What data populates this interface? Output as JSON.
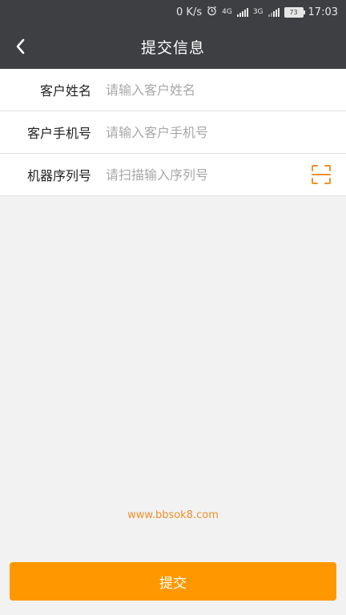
{
  "status_bar": {
    "net_speed": "0 K/s",
    "network_4g": "4G",
    "network_3g": "3G",
    "battery": "73",
    "time": "17:03",
    "icons": [
      "alarm-icon",
      "signal-icon",
      "battery-icon"
    ]
  },
  "header": {
    "title": "提交信息",
    "back_icon": "chevron-left-icon"
  },
  "form": {
    "fields": [
      {
        "label": "客户姓名",
        "placeholder": "请输入客户姓名",
        "value": ""
      },
      {
        "label": "客户手机号",
        "placeholder": "请输入客户手机号",
        "value": ""
      },
      {
        "label": "机器序列号",
        "placeholder": "请扫描输入序列号",
        "value": "",
        "action_icon": "scan-icon"
      }
    ]
  },
  "footer": {
    "website": "www.bbsok8.com",
    "submit_label": "提交"
  },
  "colors": {
    "header_bg": "#3e3f42",
    "accent": "#ff9800",
    "page_bg": "#f2f2f2"
  }
}
